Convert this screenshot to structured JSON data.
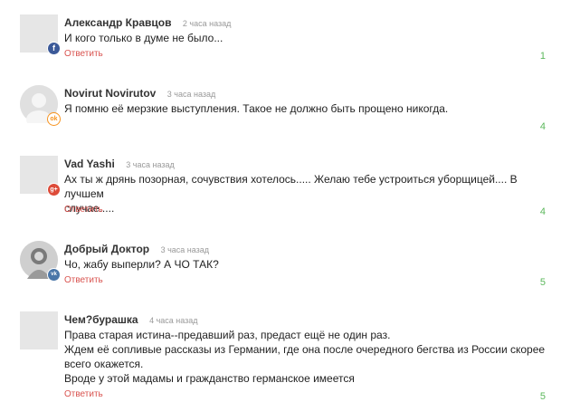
{
  "comments": [
    {
      "author": "Александр Кравцов",
      "time": "2 часа назад",
      "lines": [
        "И кого только в думе не было..."
      ],
      "reply": "Ответить",
      "count": "1",
      "badge": "facebook-icon",
      "badge_glyph": "f"
    },
    {
      "author": "Novirut Novirutov",
      "time": "3 часа назад",
      "lines": [
        "Я помню её мерзкие выступления. Такое не должно быть прощено никогда."
      ],
      "reply": "Ответить",
      "count": "4",
      "badge": "odnoklassniki-icon",
      "badge_glyph": "ok"
    },
    {
      "author": "Vad Yashi",
      "time": "3 часа назад",
      "lines": [
        "Ах ты ж дрянь позорная,  сочувствия хотелось..... Желаю тебе устроиться уборщицей.... В лучшем",
        "случае....."
      ],
      "reply": "Ответить",
      "count": "4",
      "badge": "google-plus-icon",
      "badge_glyph": "g+"
    },
    {
      "author": "Добрый Доктор",
      "time": "3 часа назад",
      "lines": [
        "Чо, жабу выперли? А ЧО ТАК?"
      ],
      "reply": "Ответить",
      "count": "5",
      "badge": "vk-icon",
      "badge_glyph": "vk"
    },
    {
      "author": "Чем?бурашка",
      "time": "4 часа назад",
      "lines": [
        "Права старая истина--предавший раз, предаст ещё не один  раз.",
        "Ждем её сопливые  рассказы из Германии, где она после очередного бегства из  России скорее",
        "всего окажется.",
        "Вроде у этой мадамы и гражданство германское имеется"
      ],
      "reply": "Ответить",
      "count": "5",
      "badge": "",
      "badge_glyph": ""
    }
  ],
  "colors": {
    "reply": "#d9534f",
    "count": "#5cb85c",
    "time": "#999999",
    "avatar_placeholder": "#e6e6e6"
  }
}
